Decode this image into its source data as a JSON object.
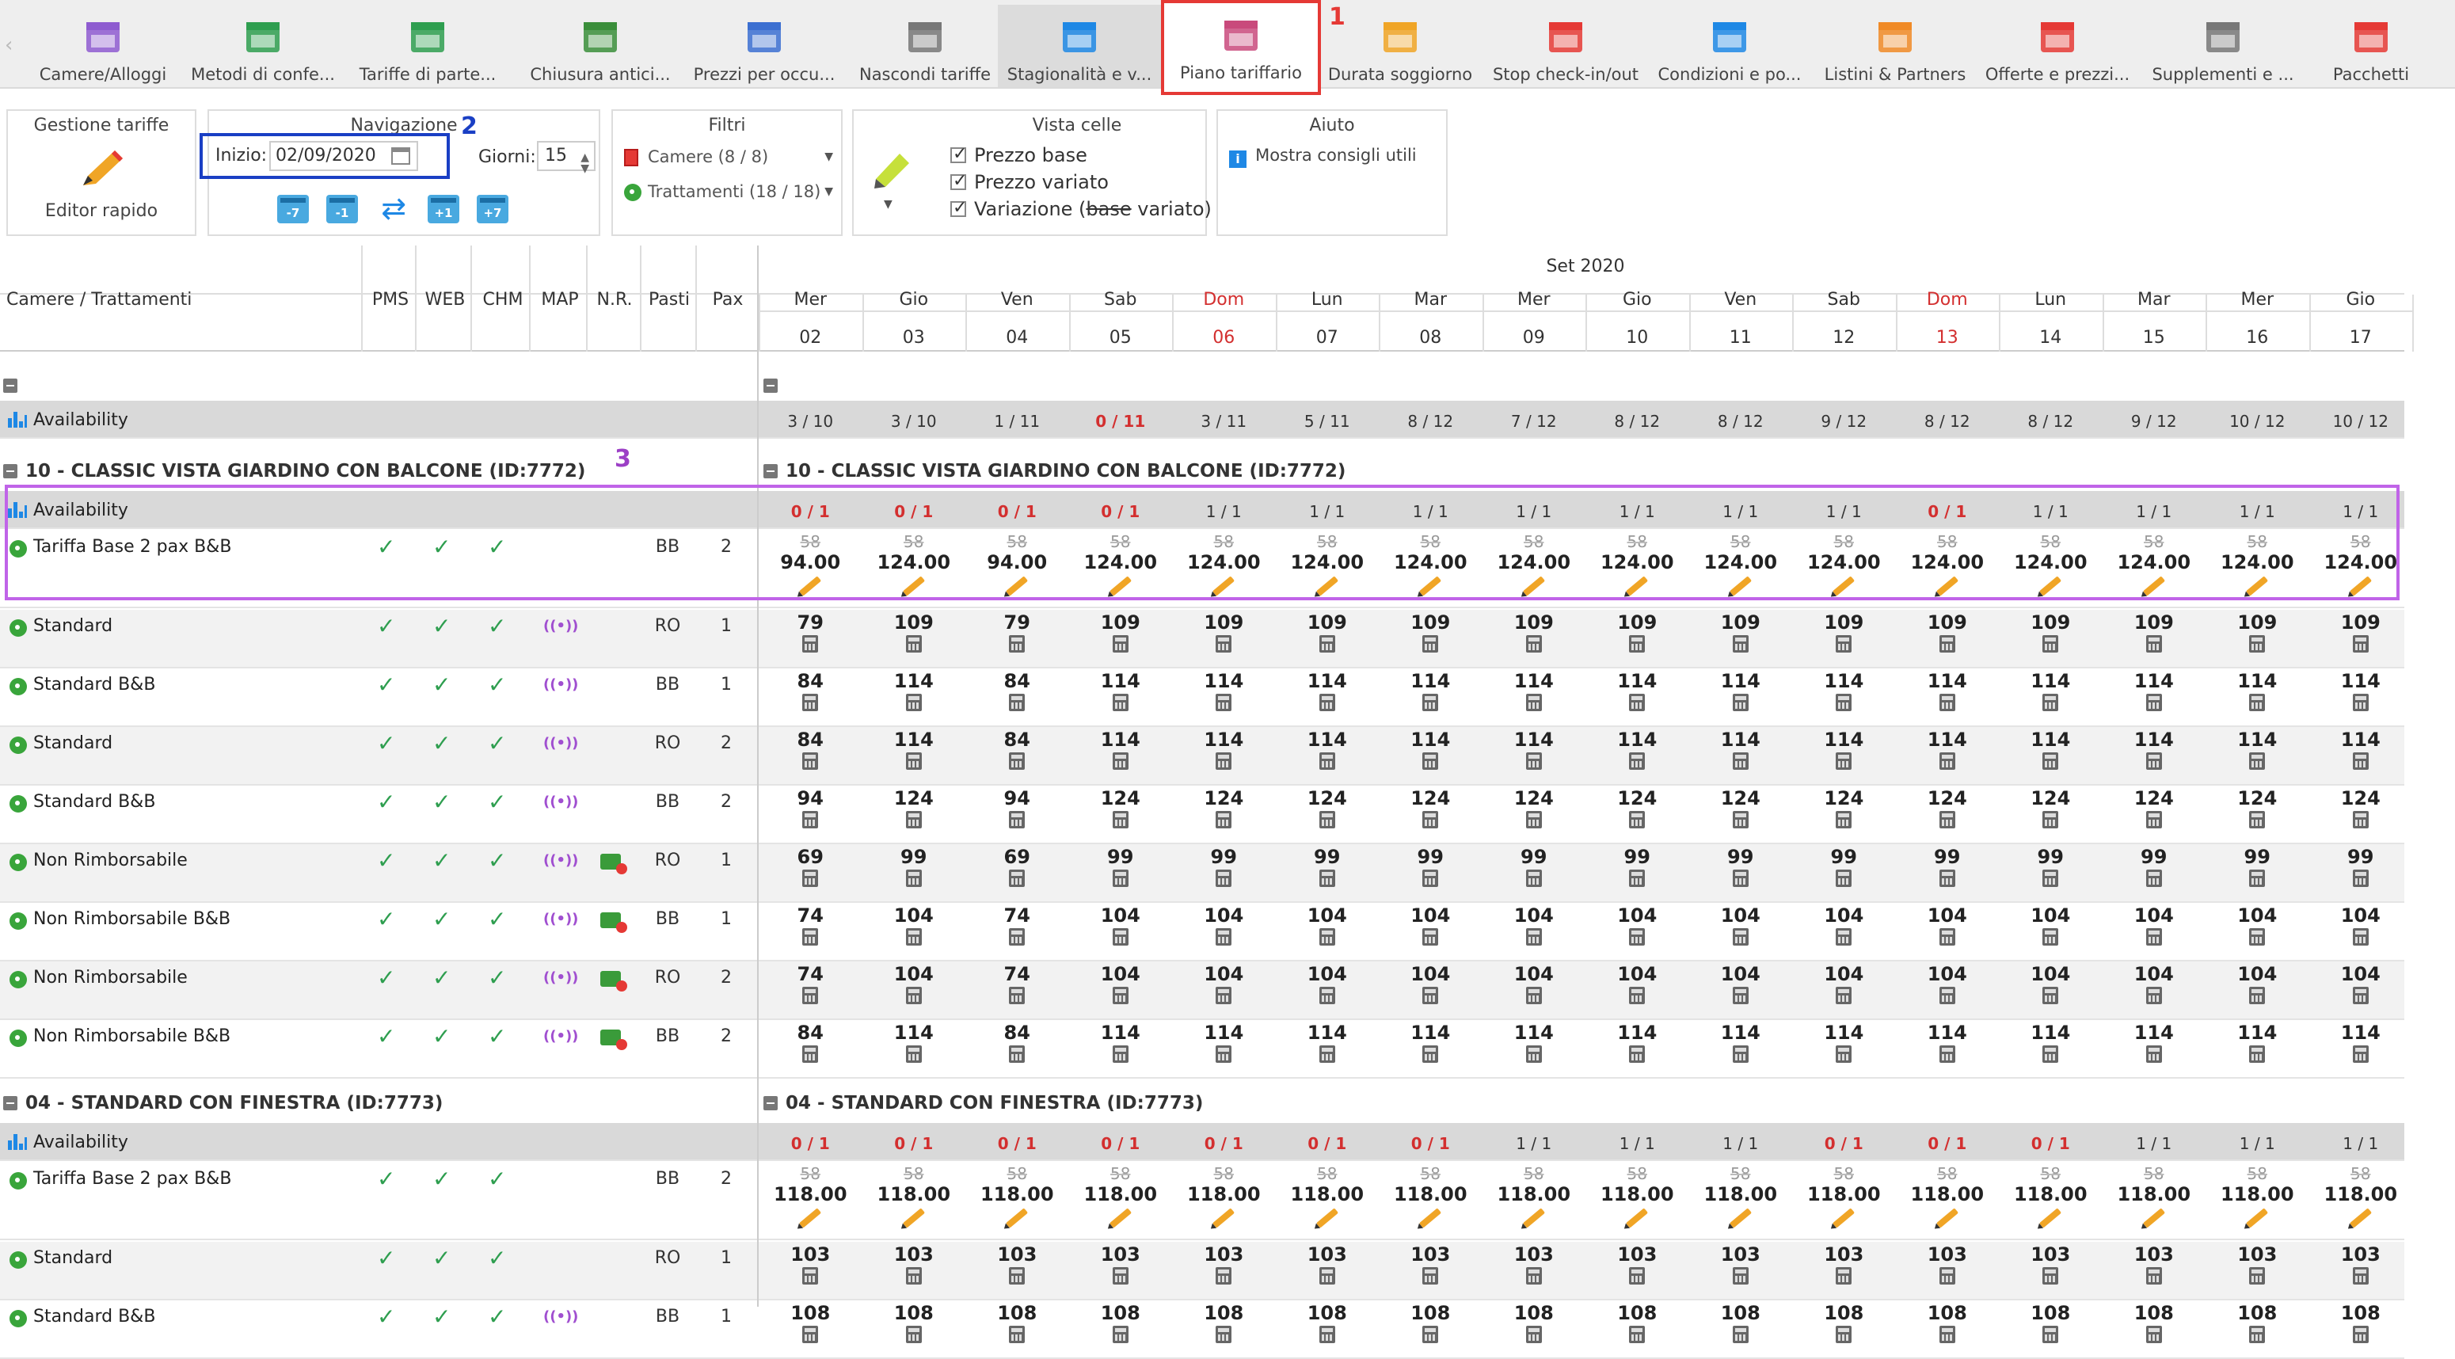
{
  "toolbar": {
    "items": [
      {
        "label": "Camere/Alloggi",
        "icon": "bed-icon"
      },
      {
        "label": "Metodi di confe...",
        "icon": "money-icon"
      },
      {
        "label": "Tariffe di parte...",
        "icon": "price-tag-icon"
      },
      {
        "label": "Chiusura antici...",
        "icon": "stopwatch-lock-icon"
      },
      {
        "label": "Prezzi per occu...",
        "icon": "bar-chart-icon"
      },
      {
        "label": "Nascondi tariffe",
        "icon": "hidden-calendar-icon"
      },
      {
        "label": "Stagionalità e v...",
        "icon": "calendar-arrows-icon"
      },
      {
        "label": "Piano tariffario",
        "icon": "calendar-grid-icon"
      },
      {
        "label": "Durata soggiorno",
        "icon": "calendar-ruler-icon"
      },
      {
        "label": "Stop check-in/out",
        "icon": "calendar-stop-icon"
      },
      {
        "label": "Condizioni e po...",
        "icon": "document-icon"
      },
      {
        "label": "Listini & Partners",
        "icon": "handshake-icon"
      },
      {
        "label": "Offerte e prezzi...",
        "icon": "percent-badge-icon"
      },
      {
        "label": "Supplementi e ...",
        "icon": "cloche-icon"
      },
      {
        "label": "Pacchetti",
        "icon": "gift-icon"
      }
    ],
    "callout1": "1",
    "callout2": "2",
    "callout3": "3"
  },
  "panels": {
    "gestione": {
      "title": "Gestione tariffe",
      "button": "Editor rapido"
    },
    "navigazione": {
      "title": "Navigazione",
      "start_label": "Inizio:",
      "start_value": "02/09/2020",
      "days_label": "Giorni:",
      "days_value": "15",
      "buttons": [
        "-7",
        "-1",
        "+1",
        "+7"
      ]
    },
    "filtri": {
      "title": "Filtri",
      "camere": "Camere (8 / 8)",
      "trattamenti": "Trattamenti (18 / 18)"
    },
    "vista": {
      "title": "Vista celle",
      "prezzo_base": "Prezzo base",
      "prezzo_variato": "Prezzo variato",
      "variazione_pre": "Variazione (",
      "variazione_base": "base",
      "variazione_post": " variato)"
    },
    "aiuto": {
      "title": "Aiuto",
      "link": "Mostra consigli utili"
    }
  },
  "grid": {
    "month": "Set 2020",
    "left_header": "Camere / Trattamenti",
    "columns": [
      "PMS",
      "WEB",
      "CHM",
      "MAP",
      "N.R.",
      "Pasti",
      "Pax"
    ],
    "days": [
      {
        "dow": "Mer",
        "d": "02"
      },
      {
        "dow": "Gio",
        "d": "03"
      },
      {
        "dow": "Ven",
        "d": "04"
      },
      {
        "dow": "Sab",
        "d": "05"
      },
      {
        "dow": "Dom",
        "d": "06",
        "sun": true
      },
      {
        "dow": "Lun",
        "d": "07"
      },
      {
        "dow": "Mar",
        "d": "08"
      },
      {
        "dow": "Mer",
        "d": "09"
      },
      {
        "dow": "Gio",
        "d": "10"
      },
      {
        "dow": "Ven",
        "d": "11"
      },
      {
        "dow": "Sab",
        "d": "12"
      },
      {
        "dow": "Dom",
        "d": "13",
        "sun": true
      },
      {
        "dow": "Lun",
        "d": "14"
      },
      {
        "dow": "Mar",
        "d": "15"
      },
      {
        "dow": "Mer",
        "d": "16"
      },
      {
        "dow": "Gio",
        "d": "17"
      }
    ],
    "availability_label": "Availability",
    "total_availability": [
      "3 / 10",
      "3 / 10",
      "1 / 11",
      "0 / 11",
      "3 / 11",
      "5 / 11",
      "8 / 12",
      "7 / 12",
      "8 / 12",
      "8 / 12",
      "9 / 12",
      "8 / 12",
      "8 / 12",
      "9 / 12",
      "10 / 12",
      "10 / 12"
    ],
    "sections": [
      {
        "title": "10 - CLASSIC VISTA GIARDINO CON BALCONE (ID:7772)",
        "availability": [
          "0 / 1",
          "0 / 1",
          "0 / 1",
          "0 / 1",
          "1 / 1",
          "1 / 1",
          "1 / 1",
          "1 / 1",
          "1 / 1",
          "1 / 1",
          "1 / 1",
          "0 / 1",
          "1 / 1",
          "1 / 1",
          "1 / 1",
          "1 / 1"
        ],
        "base_rate": {
          "name": "Tariffa Base 2 pax B&B",
          "pasti": "BB",
          "pax": "2",
          "base": "58",
          "prices": [
            "94.00",
            "124.00",
            "94.00",
            "124.00",
            "124.00",
            "124.00",
            "124.00",
            "124.00",
            "124.00",
            "124.00",
            "124.00",
            "124.00",
            "124.00",
            "124.00",
            "124.00",
            "124.00"
          ]
        },
        "rates": [
          {
            "name": "Standard",
            "map": true,
            "nr": false,
            "pasti": "RO",
            "pax": "1",
            "prices": [
              "79",
              "109",
              "79",
              "109",
              "109",
              "109",
              "109",
              "109",
              "109",
              "109",
              "109",
              "109",
              "109",
              "109",
              "109",
              "109"
            ]
          },
          {
            "name": "Standard B&B",
            "map": true,
            "nr": false,
            "pasti": "BB",
            "pax": "1",
            "prices": [
              "84",
              "114",
              "84",
              "114",
              "114",
              "114",
              "114",
              "114",
              "114",
              "114",
              "114",
              "114",
              "114",
              "114",
              "114",
              "114"
            ]
          },
          {
            "name": "Standard",
            "map": true,
            "nr": false,
            "pasti": "RO",
            "pax": "2",
            "prices": [
              "84",
              "114",
              "84",
              "114",
              "114",
              "114",
              "114",
              "114",
              "114",
              "114",
              "114",
              "114",
              "114",
              "114",
              "114",
              "114"
            ]
          },
          {
            "name": "Standard B&B",
            "map": true,
            "nr": false,
            "pasti": "BB",
            "pax": "2",
            "prices": [
              "94",
              "124",
              "94",
              "124",
              "124",
              "124",
              "124",
              "124",
              "124",
              "124",
              "124",
              "124",
              "124",
              "124",
              "124",
              "124"
            ]
          },
          {
            "name": "Non Rimborsabile",
            "map": true,
            "nr": true,
            "pasti": "RO",
            "pax": "1",
            "prices": [
              "69",
              "99",
              "69",
              "99",
              "99",
              "99",
              "99",
              "99",
              "99",
              "99",
              "99",
              "99",
              "99",
              "99",
              "99",
              "99"
            ]
          },
          {
            "name": "Non Rimborsabile B&B",
            "map": true,
            "nr": true,
            "pasti": "BB",
            "pax": "1",
            "prices": [
              "74",
              "104",
              "74",
              "104",
              "104",
              "104",
              "104",
              "104",
              "104",
              "104",
              "104",
              "104",
              "104",
              "104",
              "104",
              "104"
            ]
          },
          {
            "name": "Non Rimborsabile",
            "map": true,
            "nr": true,
            "pasti": "RO",
            "pax": "2",
            "prices": [
              "74",
              "104",
              "74",
              "104",
              "104",
              "104",
              "104",
              "104",
              "104",
              "104",
              "104",
              "104",
              "104",
              "104",
              "104",
              "104"
            ]
          },
          {
            "name": "Non Rimborsabile B&B",
            "map": true,
            "nr": true,
            "pasti": "BB",
            "pax": "2",
            "prices": [
              "84",
              "114",
              "84",
              "114",
              "114",
              "114",
              "114",
              "114",
              "114",
              "114",
              "114",
              "114",
              "114",
              "114",
              "114",
              "114"
            ]
          }
        ]
      },
      {
        "title": "04 - STANDARD CON FINESTRA (ID:7773)",
        "availability": [
          "0 / 1",
          "0 / 1",
          "0 / 1",
          "0 / 1",
          "0 / 1",
          "0 / 1",
          "0 / 1",
          "1 / 1",
          "1 / 1",
          "1 / 1",
          "0 / 1",
          "0 / 1",
          "0 / 1",
          "1 / 1",
          "1 / 1",
          "1 / 1"
        ],
        "base_rate": {
          "name": "Tariffa Base 2 pax B&B",
          "pasti": "BB",
          "pax": "2",
          "base": "58",
          "prices": [
            "118.00",
            "118.00",
            "118.00",
            "118.00",
            "118.00",
            "118.00",
            "118.00",
            "118.00",
            "118.00",
            "118.00",
            "118.00",
            "118.00",
            "118.00",
            "118.00",
            "118.00",
            "118.00"
          ]
        },
        "rates": [
          {
            "name": "Standard",
            "map": false,
            "nr": false,
            "pasti": "RO",
            "pax": "1",
            "prices": [
              "103",
              "103",
              "103",
              "103",
              "103",
              "103",
              "103",
              "103",
              "103",
              "103",
              "103",
              "103",
              "103",
              "103",
              "103",
              "103"
            ]
          },
          {
            "name": "Standard B&B",
            "map": true,
            "nr": false,
            "pasti": "BB",
            "pax": "1",
            "prices": [
              "108",
              "108",
              "108",
              "108",
              "108",
              "108",
              "108",
              "108",
              "108",
              "108",
              "108",
              "108",
              "108",
              "108",
              "108",
              "108"
            ]
          }
        ]
      }
    ]
  },
  "colors": {
    "accent_red": "#e53935",
    "callout_blue": "#1a3fc4",
    "callout_purple": "#b04fe0",
    "sunday": "#d32f2f"
  }
}
